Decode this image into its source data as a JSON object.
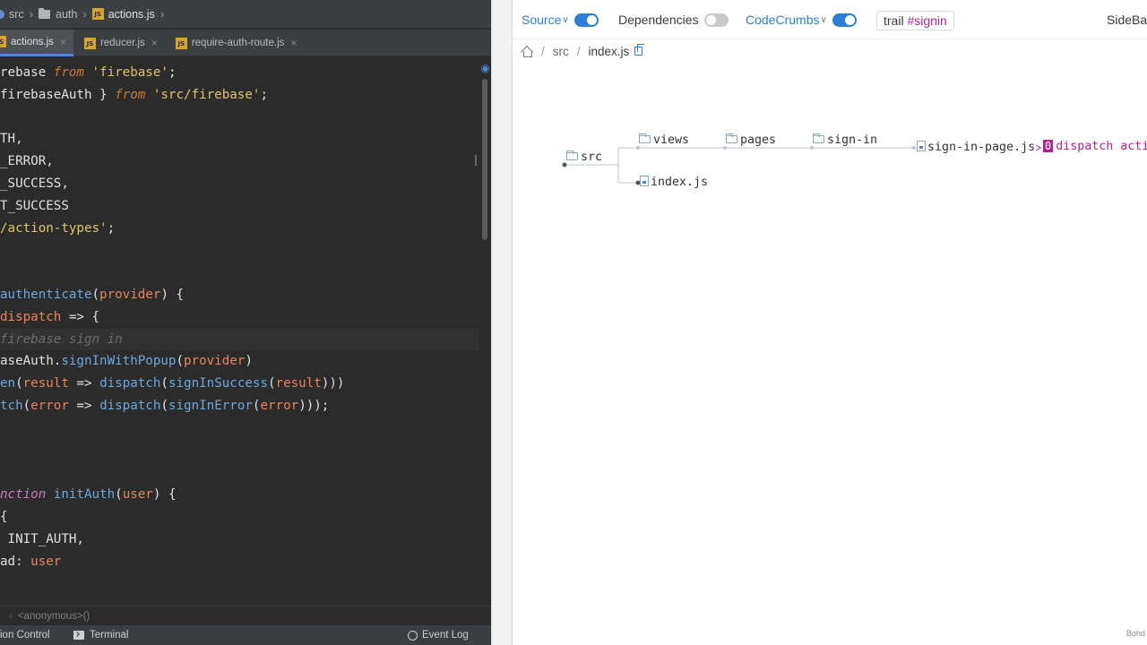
{
  "ide": {
    "breadcrumbs": [
      "src",
      "auth",
      "actions.js"
    ],
    "tabs": [
      {
        "label": "actions.js",
        "active": true
      },
      {
        "label": "reducer.js",
        "active": false
      },
      {
        "label": "require-auth-route.js",
        "active": false
      }
    ],
    "code_lines": [
      {
        "tokens": [
          [
            "plain",
            "rebase"
          ],
          [
            "plain",
            " "
          ],
          [
            "kw",
            "from"
          ],
          [
            "plain",
            " "
          ],
          [
            "str",
            "'firebase'"
          ],
          [
            "plain",
            ";"
          ]
        ]
      },
      {
        "tokens": [
          [
            "plain",
            "firebaseAuth } "
          ],
          [
            "kw",
            "from"
          ],
          [
            "plain",
            " "
          ],
          [
            "str",
            "'src/firebase'"
          ],
          [
            "plain",
            ";"
          ]
        ]
      },
      {
        "tokens": []
      },
      {
        "tokens": [
          [
            "const",
            "TH,"
          ]
        ]
      },
      {
        "tokens": [
          [
            "const",
            "_ERROR,"
          ]
        ]
      },
      {
        "tokens": [
          [
            "const",
            "_SUCCESS,"
          ]
        ]
      },
      {
        "tokens": [
          [
            "const",
            "T_SUCCESS"
          ]
        ]
      },
      {
        "tokens": [
          [
            "str",
            "/action-types'"
          ],
          [
            "plain",
            ";"
          ]
        ]
      },
      {
        "tokens": []
      },
      {
        "tokens": []
      },
      {
        "tokens": [
          [
            "fn",
            "authenticate"
          ],
          [
            "plain",
            "("
          ],
          [
            "param",
            "provider"
          ],
          [
            "plain",
            ") {"
          ]
        ]
      },
      {
        "tokens": [
          [
            "param",
            "dispatch"
          ],
          [
            "plain",
            " => {"
          ]
        ]
      },
      {
        "tokens": [
          [
            "cm",
            "firebase sign in"
          ]
        ]
      },
      {
        "tokens": [
          [
            "plain",
            "aseAuth."
          ],
          [
            "fn",
            "signInWithPopup"
          ],
          [
            "plain",
            "("
          ],
          [
            "param",
            "provider"
          ],
          [
            "plain",
            ")"
          ]
        ]
      },
      {
        "tokens": [
          [
            "fn",
            "en"
          ],
          [
            "plain",
            "("
          ],
          [
            "param",
            "result"
          ],
          [
            "plain",
            " => "
          ],
          [
            "fn",
            "dispatch"
          ],
          [
            "plain",
            "("
          ],
          [
            "fn",
            "signInSuccess"
          ],
          [
            "plain",
            "("
          ],
          [
            "param",
            "result"
          ],
          [
            "plain",
            ")))"
          ]
        ]
      },
      {
        "tokens": [
          [
            "fn",
            "tch"
          ],
          [
            "plain",
            "("
          ],
          [
            "param",
            "error"
          ],
          [
            "plain",
            " => "
          ],
          [
            "fn",
            "dispatch"
          ],
          [
            "plain",
            "("
          ],
          [
            "fn",
            "signInError"
          ],
          [
            "plain",
            "("
          ],
          [
            "param",
            "error"
          ],
          [
            "plain",
            ")));"
          ]
        ]
      },
      {
        "tokens": []
      },
      {
        "tokens": []
      },
      {
        "tokens": []
      },
      {
        "tokens": [
          [
            "kw2",
            "nction"
          ],
          [
            "plain",
            " "
          ],
          [
            "fn",
            "initAuth"
          ],
          [
            "plain",
            "("
          ],
          [
            "param",
            "user"
          ],
          [
            "plain",
            ") {"
          ]
        ]
      },
      {
        "tokens": [
          [
            "plain",
            "{"
          ]
        ]
      },
      {
        "tokens": [
          [
            "plain",
            " INIT_AUTH,"
          ]
        ]
      },
      {
        "tokens": [
          [
            "plain",
            "ad: "
          ],
          [
            "param",
            "user"
          ]
        ]
      }
    ],
    "code_crumb": "<anonymous>()",
    "status": {
      "version_control": "ion Control",
      "terminal": "Terminal",
      "event_log": "Event Log"
    }
  },
  "codecrumbs": {
    "toolbar": {
      "source": "Source",
      "source_on": true,
      "dependencies": "Dependencies",
      "dependencies_on": false,
      "codecrumbs": "CodeCrumbs",
      "codecrumbs_on": true,
      "trail_prefix": "trail ",
      "trail_tag": "#signin",
      "sidebar": "SideBar"
    },
    "path": {
      "dir": "src",
      "file": "index.js"
    },
    "tree": {
      "root": "src",
      "folders": [
        "views",
        "pages",
        "sign-in"
      ],
      "file": "sign-in-page.js",
      "root_file": "index.js"
    },
    "crumb": {
      "badge": "0",
      "text": "dispatch actio"
    },
    "footer": "Bohd"
  },
  "colors": {
    "accent_blue": "#2b7fd6",
    "crumb_magenta": "#b0268f",
    "ide_bg": "#2b2b2b"
  }
}
